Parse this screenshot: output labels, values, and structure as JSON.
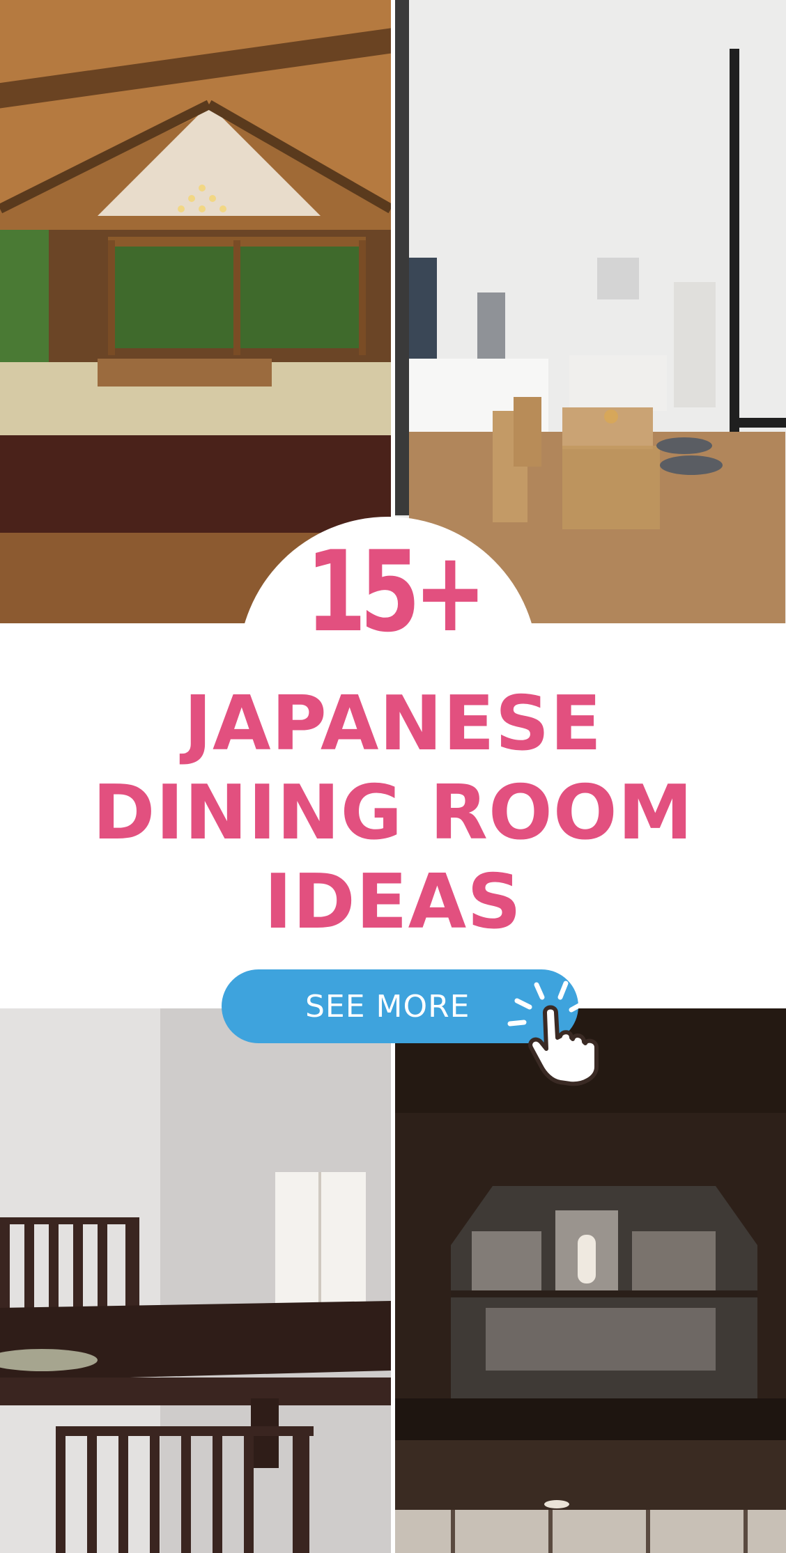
{
  "headline": {
    "number": "15+",
    "line1": "JAPANESE",
    "line2": "DINING ROOM",
    "line3": "IDEAS"
  },
  "cta": {
    "label": "SEE MORE",
    "icon": "pointing-hand-click-icon"
  },
  "colors": {
    "accent_pink": "#e2507f",
    "button_blue": "#3ea3dd",
    "background": "#ffffff"
  }
}
